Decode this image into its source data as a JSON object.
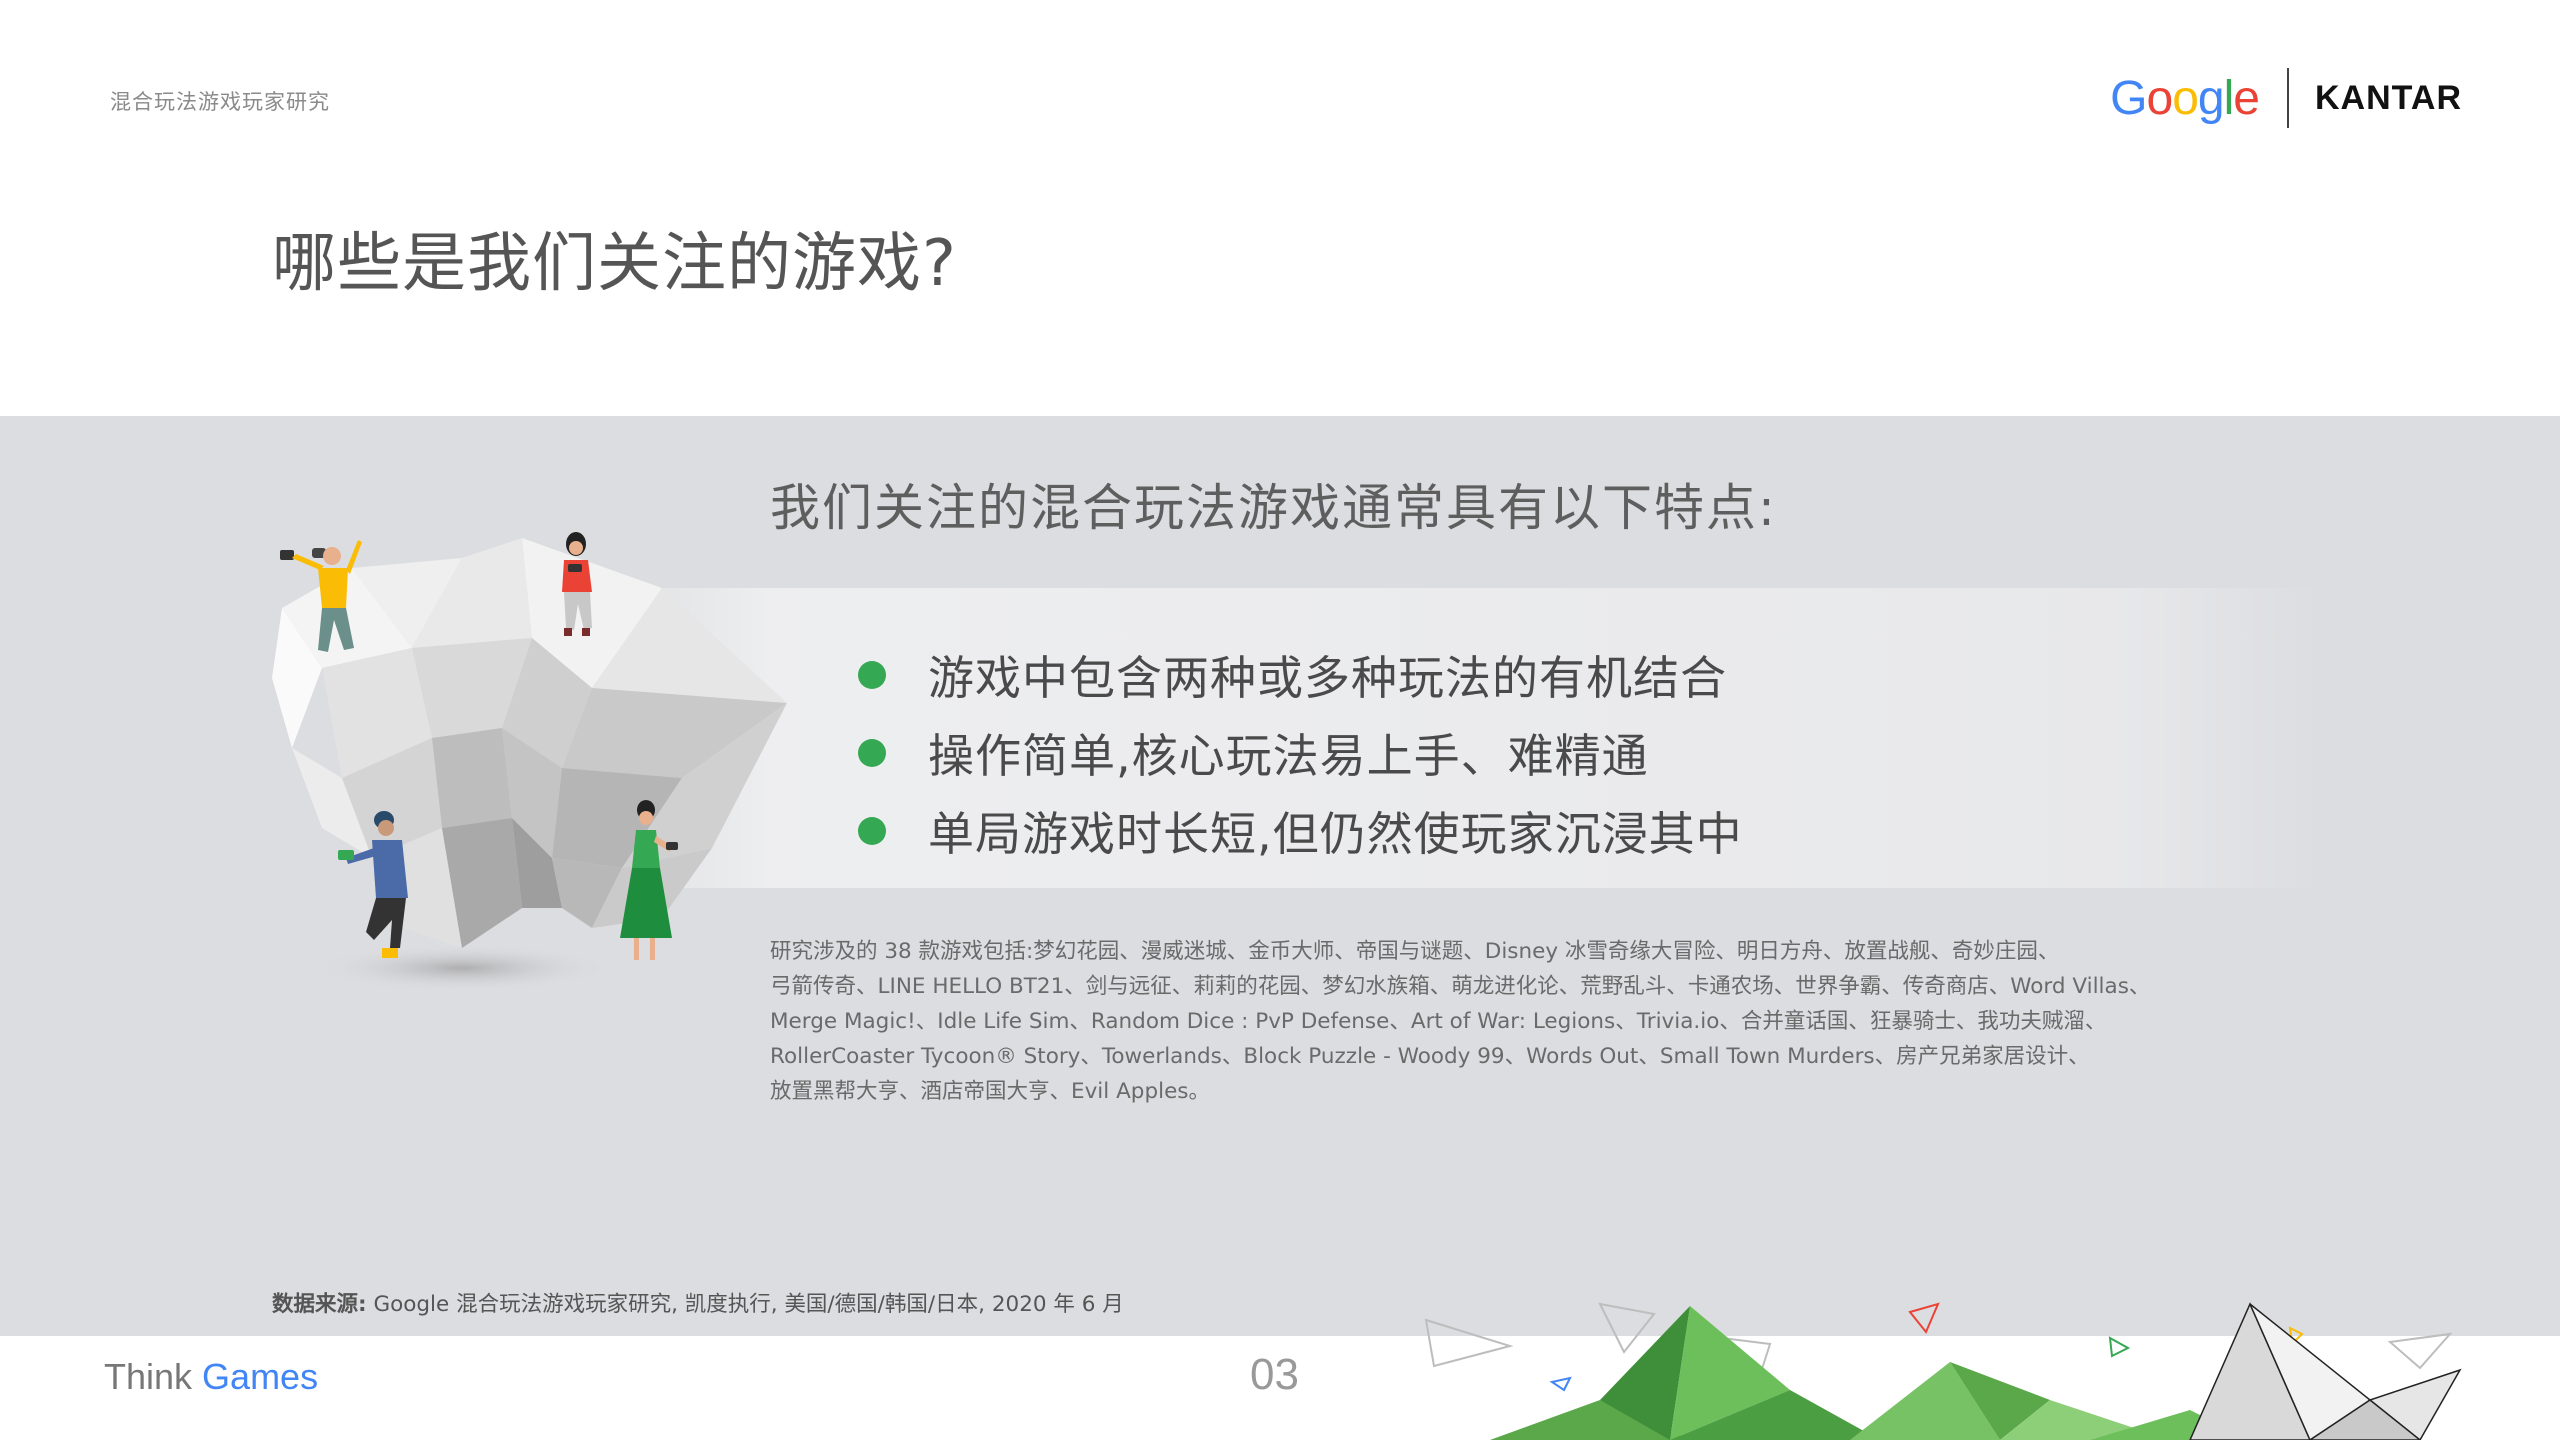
{
  "header": {
    "report_label": "混合玩法游戏玩家研究",
    "google_logo": "Google",
    "kantar_logo": "KANTAR"
  },
  "title": "哪些是我们关注的游戏?",
  "panel": {
    "heading": "我们关注的混合玩法游戏通常具有以下特点:",
    "features": [
      "游戏中包含两种或多种玩法的有机结合",
      "操作简单,核心玩法易上手、难精通",
      "单局游戏时长短,但仍然使玩家沉浸其中"
    ],
    "games_list_lines": [
      "研究涉及的 38 款游戏包括:梦幻花园、漫威迷城、金币大师、帝国与谜题、Disney 冰雪奇缘大冒险、明日方舟、放置战舰、奇妙庄园、",
      "弓箭传奇、LINE HELLO BT21、剑与远征、莉莉的花园、梦幻水族箱、萌龙进化论、荒野乱斗、卡通农场、世界争霸、传奇商店、Word Villas、",
      "Merge Magic!、Idle Life Sim、Random Dice : PvP Defense、Art of War: Legions、Trivia.io、合并童话国、狂暴骑士、我功夫贼溜、",
      "RollerCoaster Tycoon® Story、Towerlands、Block Puzzle - Woody 99、Words Out、Small Town Murders、房产兄弟家居设计、",
      "放置黑帮大亨、酒店帝国大亨、Evil Apples。"
    ]
  },
  "source": {
    "label": "数据来源:",
    "text": " Google 混合玩法游戏玩家研究, 凯度执行, 美国/德国/韩国/日本, 2020 年 6 月"
  },
  "footer": {
    "think": "Think",
    "games": "Games",
    "page_number": "03"
  },
  "colors": {
    "accent_green": "#34a853",
    "google_blue": "#4285f4",
    "google_red": "#ea4335",
    "google_yellow": "#fbbc05",
    "panel_gray": "#dcdde0"
  }
}
